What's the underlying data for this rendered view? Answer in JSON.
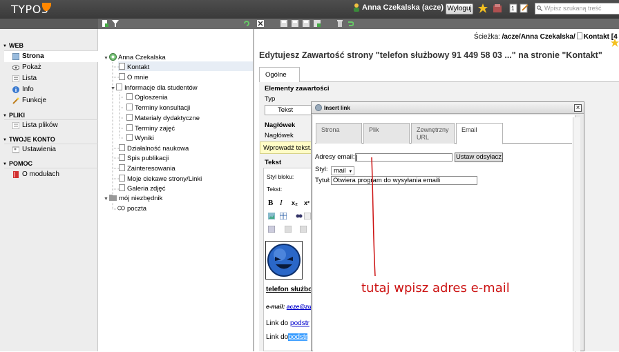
{
  "topbar": {
    "logo": "TYPO3",
    "user": "Anna Czekalska (acze)",
    "logout": "Wyloguj",
    "search_placeholder": "Wpisz szukaną treść"
  },
  "modules": {
    "web": "WEB",
    "web_items": [
      "Strona",
      "Pokaż",
      "Lista",
      "Info",
      "Funkcje"
    ],
    "pliki": "PLIKI",
    "pliki_items": [
      "Lista plików"
    ],
    "konto": "TWOJE KONTO",
    "konto_items": [
      "Ustawienia"
    ],
    "pomoc": "POMOC",
    "pomoc_items": [
      "O modułach"
    ]
  },
  "tree": {
    "root": "Anna Czekalska",
    "l1a": [
      "Kontakt",
      "O mnie",
      "Informacje dla studentów"
    ],
    "l2": [
      "Ogłoszenia",
      "Terminy konsultacji",
      "Materiały dydaktyczne",
      "Terminy zajęć",
      "Wyniki"
    ],
    "l1b": [
      "Działalność naukowa",
      "Spis publikacji",
      "Zainteresowania",
      "Moje ciekawe strony/Linki",
      "Galeria zdjęć"
    ],
    "folder": "mój niezbędnik",
    "folder_child": "poczta"
  },
  "doc": {
    "path_label": "Ścieżka:",
    "path_value": "/acze/Anna Czekalska/",
    "path_page": "Kontakt [4",
    "heading": "Edytujesz Zawartość strony \"telefon służbowy 91 449 58 03 ...\" na stronie \"Kontakt\"",
    "tab": "Ogólne",
    "section_content": "Elementy zawartości",
    "type_label": "Typ",
    "type_value": "Tekst",
    "header_section": "Nagłówek",
    "header_label": "Nagłówek",
    "tooltip": "Wprowadź tekst.",
    "text_section": "Tekst",
    "block_style": "Styl bloku:",
    "text_style": "Tekst:",
    "rte_bold": "B",
    "rte_italic": "I",
    "rte_sub": "x₂",
    "rte_sup": "x²",
    "content_title": "telefon służbo",
    "email_prefix": "e-mail: ",
    "email_link": "acze@zut",
    "link1_prefix": "Link do ",
    "link1_text": "podstr",
    "link2_prefix": "Link do",
    "link2_text": "podstr"
  },
  "modal": {
    "title": "Insert link",
    "close": "×",
    "tabs": [
      "Strona",
      "Plik",
      "Zewnętrzny URL",
      "Email"
    ],
    "email_label": "Adresy email:",
    "set_button": "Ustaw odsyłacz",
    "style_label": "Styl:",
    "style_value": "mail",
    "title_label": "Tytuł:",
    "title_value": "Otwiera program do wysyłania emaili"
  },
  "annotation": "tutaj wpisz adres e-mail",
  "colors": {
    "topbar": "#444444",
    "accent": "#ff8700",
    "annotation": "#cc1111",
    "link": "#0000cc"
  }
}
